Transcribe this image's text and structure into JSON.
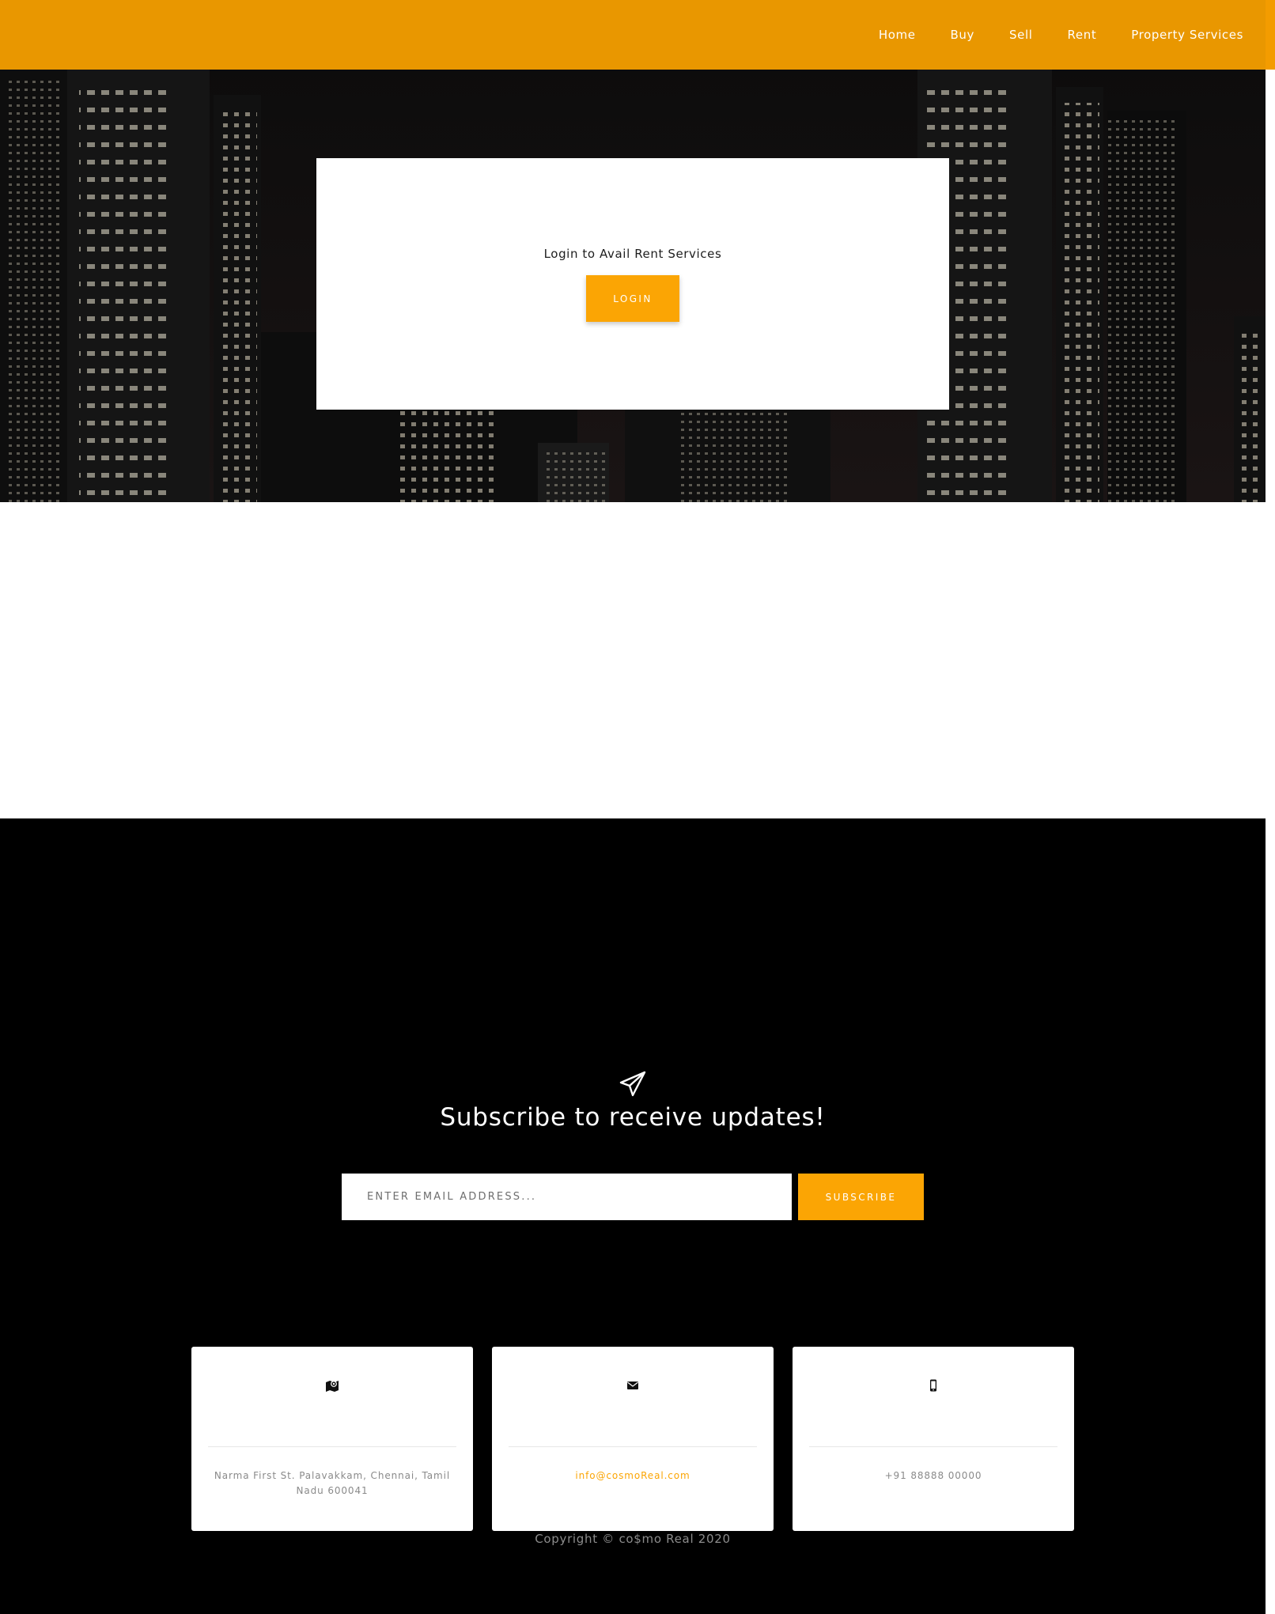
{
  "nav": {
    "items": [
      {
        "label": "Home"
      },
      {
        "label": "Buy"
      },
      {
        "label": "Sell"
      },
      {
        "label": "Rent"
      },
      {
        "label": "Property Services"
      }
    ]
  },
  "login_card": {
    "message": "Login to Avail Rent Services",
    "button_label": "LOGIN"
  },
  "subscribe": {
    "icon": "paper-plane-icon",
    "title": "Subscribe to receive updates!",
    "email_placeholder": "ENTER EMAIL ADDRESS...",
    "email_value": "",
    "button_label": "SUBSCRIBE"
  },
  "contacts": [
    {
      "icon": "map-marker-icon",
      "value": "Narma First St. Palavakkam, Chennai, Tamil Nadu 600041"
    },
    {
      "icon": "envelope-icon",
      "value": "info@cosmoReal.com"
    },
    {
      "icon": "mobile-phone-icon",
      "value": "+91 88888 00000"
    }
  ],
  "footer": {
    "copyright": "Copyright © co$mo Real 2020"
  },
  "colors": {
    "header": "#e99700",
    "accent": "#fba504",
    "footer_bg": "#000000",
    "link": "#fba504"
  }
}
